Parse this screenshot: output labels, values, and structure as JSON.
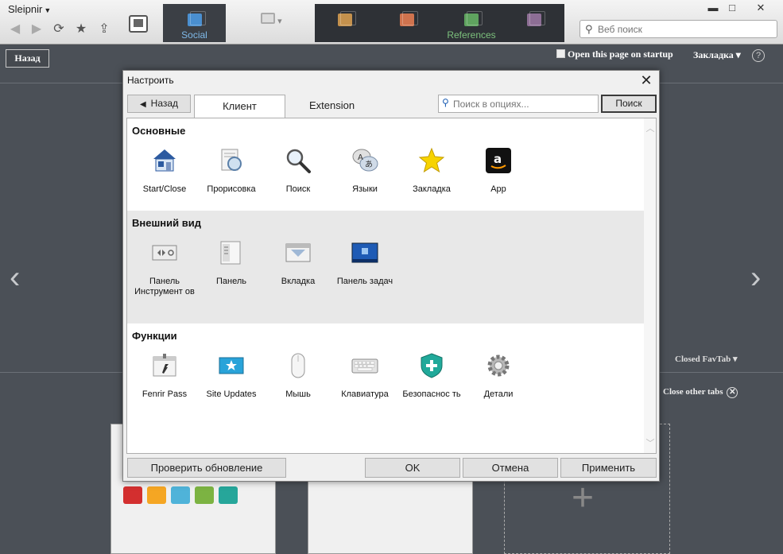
{
  "browser": {
    "app_title": "Sleipnir",
    "search_placeholder": "Веб поиск",
    "tabs": [
      {
        "label": "Social",
        "color": "#4a8fd0"
      },
      {
        "label": "",
        "color": "#b3b3b3"
      },
      {
        "label": "",
        "color": "#c4914d"
      },
      {
        "label": "",
        "color": "#d0734e"
      },
      {
        "label": "References",
        "color": "#5fa35f"
      },
      {
        "label": "",
        "color": "#8d6e95"
      }
    ],
    "window_buttons": {
      "minimize": "▬",
      "maximize": "□",
      "close": "✕"
    }
  },
  "page": {
    "back_label": "Назад",
    "open_on_startup": "Open this page on startup",
    "bookmark_dropdown": "Закладка ▾",
    "help": "?",
    "closed_favtab": "Closed FavTab ▾",
    "close_other_tabs": "Close other tabs",
    "nav_left": "‹",
    "nav_right": "›"
  },
  "dialog": {
    "title": "Настроить",
    "close": "✕",
    "back_label": "Назад",
    "tabs": [
      "Клиент",
      "Extension"
    ],
    "active_tab": "Клиент",
    "search_placeholder": "Поиск в опциях...",
    "search_button": "Поиск",
    "sections": [
      {
        "title": "Основные",
        "items": [
          {
            "label": "Start/Close",
            "icon": "home-icon"
          },
          {
            "label": "Прорисовка",
            "icon": "page-zoom-icon"
          },
          {
            "label": "Поиск",
            "icon": "magnifier-icon"
          },
          {
            "label": "Языки",
            "icon": "languages-icon"
          },
          {
            "label": "Закладка",
            "icon": "star-icon"
          },
          {
            "label": "App",
            "icon": "amazon-icon"
          }
        ]
      },
      {
        "title": "Внешний вид",
        "items": [
          {
            "label": "Панель Инструмент ов",
            "icon": "toolbar-icon"
          },
          {
            "label": "Панель",
            "icon": "panel-icon"
          },
          {
            "label": "Вкладка",
            "icon": "tab-icon"
          },
          {
            "label": "Панель задач",
            "icon": "taskbar-icon"
          }
        ]
      },
      {
        "title": "Функции",
        "items": [
          {
            "label": "Fenrir Pass",
            "icon": "fenrir-pass-icon"
          },
          {
            "label": "Site Updates",
            "icon": "site-updates-icon"
          },
          {
            "label": "Мышь",
            "icon": "mouse-icon"
          },
          {
            "label": "Клавиатура",
            "icon": "keyboard-icon"
          },
          {
            "label": "Безопаснос ть",
            "icon": "shield-icon"
          },
          {
            "label": "Детали",
            "icon": "gear-icon"
          }
        ]
      }
    ],
    "buttons": {
      "check_update": "Проверить обновление",
      "ok": "OK",
      "cancel": "Отмена",
      "apply": "Применить"
    }
  }
}
